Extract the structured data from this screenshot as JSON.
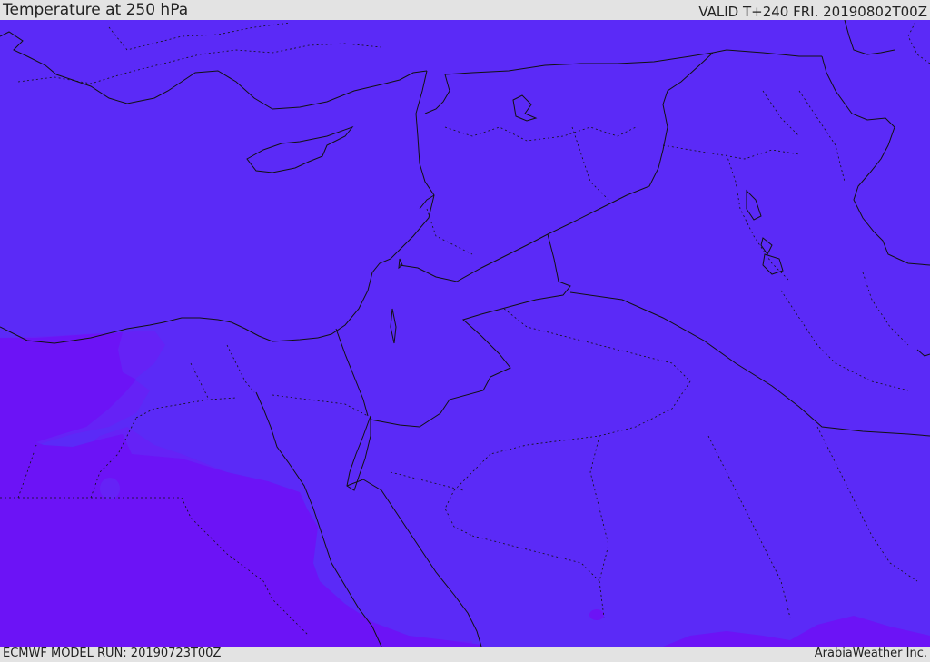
{
  "header": {
    "title": "Temperature at 250 hPa",
    "valid": "VALID T+240 FRI. 20190802T00Z"
  },
  "footer": {
    "model_run": "ECMWF MODEL RUN: 20190723T00Z",
    "credit": "ArabiaWeather Inc."
  },
  "map": {
    "field": "temperature-250hPa",
    "colors": {
      "background": "#5b2af7",
      "warm_band": "#6c13f6",
      "mid_band": "#6522f6",
      "coastline": "#111111",
      "border": "#111111"
    }
  }
}
